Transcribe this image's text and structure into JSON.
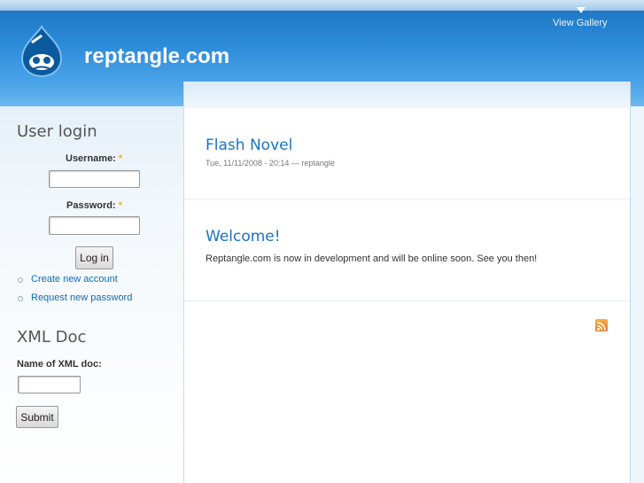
{
  "header": {
    "site_name": "reptangle.com",
    "view_gallery": "View Gallery",
    "logo_icon": "drupal-drop-icon"
  },
  "sidebar": {
    "user_login": {
      "title": "User login",
      "username_label": "Username:",
      "username_value": "",
      "password_label": "Password:",
      "password_value": "",
      "required_mark": "*",
      "login_button": "Log in",
      "links": [
        "Create new account",
        "Request new password"
      ]
    },
    "xml_doc": {
      "title": "XML Doc",
      "name_label": "Name of XML doc:",
      "name_value": "",
      "submit_button": "Submit"
    }
  },
  "main": {
    "nodes": [
      {
        "title": "Flash Novel",
        "meta": "Tue, 11/11/2008 - 20:14 — reptangle"
      },
      {
        "title": "Welcome!",
        "body": "Reptangle.com is now in development and will be online soon. See you then!"
      }
    ],
    "feed_icon": "rss-feed-icon"
  },
  "colors": {
    "header_blue": "#2b8ad8",
    "link_blue": "#0e6db6",
    "title_blue": "#1b73c0",
    "required_orange": "#f6a828",
    "feed_orange": "#f39c33"
  }
}
